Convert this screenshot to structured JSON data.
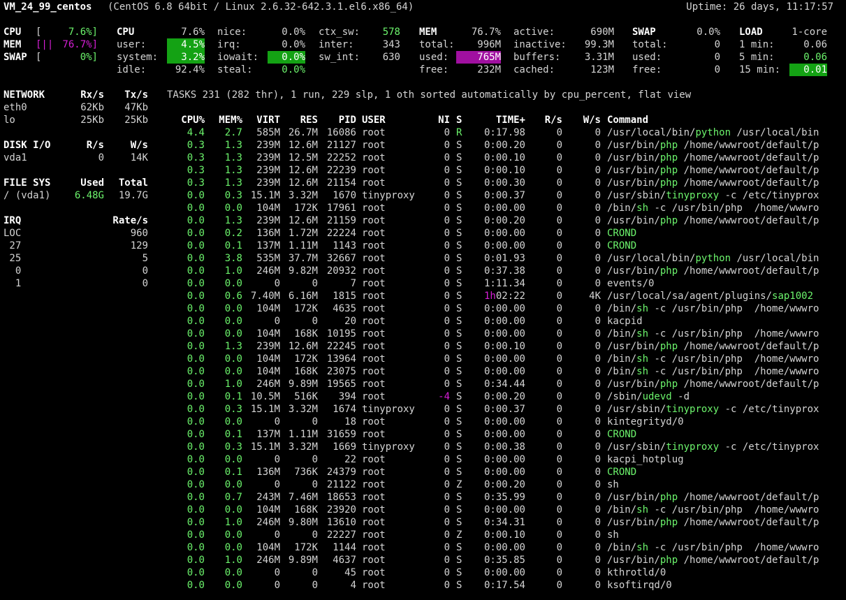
{
  "header": {
    "hostname": "VM_24_99_centos",
    "os": "(CentOS 6.8 64bit / Linux 2.6.32-642.3.1.el6.x86_64)",
    "uptime": "Uptime: 26 days, 11:17:57"
  },
  "quicklook": {
    "cpu_label": "CPU",
    "cpu_bar": "[",
    "cpu_pct": "7.6%]",
    "mem_label": "MEM",
    "mem_bar": "[||",
    "mem_pct": "76.7%]",
    "swap_label": "SWAP",
    "swap_bar": "[",
    "swap_pct": "0%]"
  },
  "cpu": {
    "title": "CPU",
    "total": "7.6%",
    "user_l": "user:",
    "user": "4.5%",
    "system_l": "system:",
    "system": "3.2%",
    "idle_l": "idle:",
    "idle": "92.4%",
    "nice_l": "nice:",
    "nice": "0.0%",
    "irq_l": "irq:",
    "irq": "0.0%",
    "iowait_l": "iowait:",
    "iowait": "0.0%",
    "steal_l": "steal:",
    "steal": "0.0%",
    "ctx_l": "ctx_sw:",
    "ctx": "578",
    "inter_l": "inter:",
    "inter": "343",
    "swint_l": "sw_int:",
    "swint": "630"
  },
  "mem": {
    "title": "MEM",
    "pct": "76.7%",
    "total_l": "total:",
    "total": "996M",
    "used_l": "used:",
    "used": "765M",
    "free_l": "free:",
    "free": "232M",
    "active_l": "active:",
    "active": "690M",
    "inactive_l": "inactive:",
    "inactive": "99.3M",
    "buffers_l": "buffers:",
    "buffers": "3.31M",
    "cached_l": "cached:",
    "cached": "123M"
  },
  "swap": {
    "title": "SWAP",
    "pct": "0.0%",
    "total_l": "total:",
    "total": "0",
    "used_l": "used:",
    "used": "0",
    "free_l": "free:",
    "free": "0"
  },
  "load": {
    "title": "LOAD",
    "cores": "1-core",
    "m1_l": "1 min:",
    "m1": "0.06",
    "m5_l": "5 min:",
    "m5": "0.06",
    "m15_l": "15 min:",
    "m15": "0.01"
  },
  "network": {
    "title": "NETWORK",
    "rx": "Rx/s",
    "tx": "Tx/s",
    "rows": [
      {
        "name": "eth0",
        "rx": "62Kb",
        "tx": "47Kb"
      },
      {
        "name": "lo",
        "rx": "25Kb",
        "tx": "25Kb"
      }
    ]
  },
  "disk": {
    "title": "DISK I/O",
    "r": "R/s",
    "w": "W/s",
    "rows": [
      {
        "name": "vda1",
        "r": "0",
        "w": "14K"
      }
    ]
  },
  "fs": {
    "title": "FILE SYS",
    "used": "Used",
    "total": "Total",
    "rows": [
      {
        "name": "/ (vda1)",
        "used": "6.48G",
        "total": "19.7G"
      }
    ]
  },
  "irq": {
    "title": "IRQ",
    "rate": "Rate/s",
    "rows": [
      {
        "name": "LOC",
        "rate": "960"
      },
      {
        "name": " 27",
        "rate": "129"
      },
      {
        "name": " 25",
        "rate": "5"
      },
      {
        "name": "  0",
        "rate": "0"
      },
      {
        "name": "  1",
        "rate": "0"
      }
    ]
  },
  "tasks_line": "TASKS 231 (282 thr), 1 run, 229 slp, 1 oth sorted automatically by cpu_percent, flat view",
  "columns": {
    "cpu": "CPU%",
    "mem": "MEM%",
    "virt": "VIRT",
    "res": "RES",
    "pid": "PID",
    "user": "USER",
    "ni": "NI",
    "s": "S",
    "time": "TIME+",
    "r": "R/s",
    "w": "W/s",
    "cmd": "Command"
  },
  "processes": [
    {
      "cpu": "4.4",
      "mem": "2.7",
      "virt": "585M",
      "res": "26.7M",
      "pid": "16086",
      "user": "root",
      "ni": "0",
      "s": "R",
      "th": "",
      "time": "0:17.98",
      "r": "0",
      "w": "0",
      "cmd": [
        "/usr/local/bin/",
        "python",
        " /usr/local/bin"
      ]
    },
    {
      "cpu": "0.3",
      "mem": "1.3",
      "virt": "239M",
      "res": "12.6M",
      "pid": "21127",
      "user": "root",
      "ni": "0",
      "s": "S",
      "th": "",
      "time": "0:00.20",
      "r": "0",
      "w": "0",
      "cmd": [
        "/usr/bin/",
        "php",
        " /home/wwwroot/default/p"
      ]
    },
    {
      "cpu": "0.3",
      "mem": "1.3",
      "virt": "239M",
      "res": "12.5M",
      "pid": "22252",
      "user": "root",
      "ni": "0",
      "s": "S",
      "th": "",
      "time": "0:00.10",
      "r": "0",
      "w": "0",
      "cmd": [
        "/usr/bin/",
        "php",
        " /home/wwwroot/default/p"
      ]
    },
    {
      "cpu": "0.3",
      "mem": "1.3",
      "virt": "239M",
      "res": "12.6M",
      "pid": "22239",
      "user": "root",
      "ni": "0",
      "s": "S",
      "th": "",
      "time": "0:00.10",
      "r": "0",
      "w": "0",
      "cmd": [
        "/usr/bin/",
        "php",
        " /home/wwwroot/default/p"
      ]
    },
    {
      "cpu": "0.3",
      "mem": "1.3",
      "virt": "239M",
      "res": "12.6M",
      "pid": "21154",
      "user": "root",
      "ni": "0",
      "s": "S",
      "th": "",
      "time": "0:00.30",
      "r": "0",
      "w": "0",
      "cmd": [
        "/usr/bin/",
        "php",
        " /home/wwwroot/default/p"
      ]
    },
    {
      "cpu": "0.0",
      "mem": "0.3",
      "virt": "15.1M",
      "res": "3.32M",
      "pid": "1670",
      "user": "tinyproxy",
      "ni": "0",
      "s": "S",
      "th": "",
      "time": "0:00.37",
      "r": "0",
      "w": "0",
      "cmd": [
        "/usr/sbin/",
        "tinyproxy",
        " -c /etc/tinyprox"
      ]
    },
    {
      "cpu": "0.0",
      "mem": "0.0",
      "virt": "104M",
      "res": "172K",
      "pid": "17961",
      "user": "root",
      "ni": "0",
      "s": "S",
      "th": "",
      "time": "0:00.00",
      "r": "0",
      "w": "0",
      "cmd": [
        "/bin/",
        "sh",
        " -c /usr/bin/php  /home/wwwro"
      ]
    },
    {
      "cpu": "0.0",
      "mem": "1.3",
      "virt": "239M",
      "res": "12.6M",
      "pid": "21159",
      "user": "root",
      "ni": "0",
      "s": "S",
      "th": "",
      "time": "0:00.20",
      "r": "0",
      "w": "0",
      "cmd": [
        "/usr/bin/",
        "php",
        " /home/wwwroot/default/p"
      ]
    },
    {
      "cpu": "0.0",
      "mem": "0.2",
      "virt": "136M",
      "res": "1.72M",
      "pid": "22224",
      "user": "root",
      "ni": "0",
      "s": "S",
      "th": "",
      "time": "0:00.00",
      "r": "0",
      "w": "0",
      "cmd": [
        "",
        "CROND",
        ""
      ]
    },
    {
      "cpu": "0.0",
      "mem": "0.1",
      "virt": "137M",
      "res": "1.11M",
      "pid": "1143",
      "user": "root",
      "ni": "0",
      "s": "S",
      "th": "",
      "time": "0:00.00",
      "r": "0",
      "w": "0",
      "cmd": [
        "",
        "CROND",
        ""
      ]
    },
    {
      "cpu": "0.0",
      "mem": "3.8",
      "virt": "535M",
      "res": "37.7M",
      "pid": "32667",
      "user": "root",
      "ni": "0",
      "s": "S",
      "th": "",
      "time": "0:01.93",
      "r": "0",
      "w": "0",
      "cmd": [
        "/usr/local/bin/",
        "python",
        " /usr/local/bin"
      ]
    },
    {
      "cpu": "0.0",
      "mem": "1.0",
      "virt": "246M",
      "res": "9.82M",
      "pid": "20932",
      "user": "root",
      "ni": "0",
      "s": "S",
      "th": "",
      "time": "0:37.38",
      "r": "0",
      "w": "0",
      "cmd": [
        "/usr/bin/",
        "php",
        " /home/wwwroot/default/p"
      ]
    },
    {
      "cpu": "0.0",
      "mem": "0.0",
      "virt": "0",
      "res": "0",
      "pid": "7",
      "user": "root",
      "ni": "0",
      "s": "S",
      "th": "",
      "time": "1:11.34",
      "r": "0",
      "w": "0",
      "cmd": [
        "events/0",
        "",
        ""
      ]
    },
    {
      "cpu": "0.0",
      "mem": "0.6",
      "virt": "7.40M",
      "res": "6.16M",
      "pid": "1815",
      "user": "root",
      "ni": "0",
      "s": "S",
      "th": "1h",
      "time": "02:22",
      "r": "0",
      "w": "4K",
      "cmd": [
        "/usr/local/sa/agent/plugins/",
        "sap1002",
        ""
      ]
    },
    {
      "cpu": "0.0",
      "mem": "0.0",
      "virt": "104M",
      "res": "172K",
      "pid": "4635",
      "user": "root",
      "ni": "0",
      "s": "S",
      "th": "",
      "time": "0:00.00",
      "r": "0",
      "w": "0",
      "cmd": [
        "/bin/",
        "sh",
        " -c /usr/bin/php  /home/wwwro"
      ]
    },
    {
      "cpu": "0.0",
      "mem": "0.0",
      "virt": "0",
      "res": "0",
      "pid": "20",
      "user": "root",
      "ni": "0",
      "s": "S",
      "th": "",
      "time": "0:00.00",
      "r": "0",
      "w": "0",
      "cmd": [
        "kacpid",
        "",
        ""
      ]
    },
    {
      "cpu": "0.0",
      "mem": "0.0",
      "virt": "104M",
      "res": "168K",
      "pid": "10195",
      "user": "root",
      "ni": "0",
      "s": "S",
      "th": "",
      "time": "0:00.00",
      "r": "0",
      "w": "0",
      "cmd": [
        "/bin/",
        "sh",
        " -c /usr/bin/php  /home/wwwro"
      ]
    },
    {
      "cpu": "0.0",
      "mem": "1.3",
      "virt": "239M",
      "res": "12.6M",
      "pid": "22245",
      "user": "root",
      "ni": "0",
      "s": "S",
      "th": "",
      "time": "0:00.10",
      "r": "0",
      "w": "0",
      "cmd": [
        "/usr/bin/",
        "php",
        " /home/wwwroot/default/p"
      ]
    },
    {
      "cpu": "0.0",
      "mem": "0.0",
      "virt": "104M",
      "res": "172K",
      "pid": "13964",
      "user": "root",
      "ni": "0",
      "s": "S",
      "th": "",
      "time": "0:00.00",
      "r": "0",
      "w": "0",
      "cmd": [
        "/bin/",
        "sh",
        " -c /usr/bin/php  /home/wwwro"
      ]
    },
    {
      "cpu": "0.0",
      "mem": "0.0",
      "virt": "104M",
      "res": "168K",
      "pid": "23075",
      "user": "root",
      "ni": "0",
      "s": "S",
      "th": "",
      "time": "0:00.00",
      "r": "0",
      "w": "0",
      "cmd": [
        "/bin/",
        "sh",
        " -c /usr/bin/php  /home/wwwro"
      ]
    },
    {
      "cpu": "0.0",
      "mem": "1.0",
      "virt": "246M",
      "res": "9.89M",
      "pid": "19565",
      "user": "root",
      "ni": "0",
      "s": "S",
      "th": "",
      "time": "0:34.44",
      "r": "0",
      "w": "0",
      "cmd": [
        "/usr/bin/",
        "php",
        " /home/wwwroot/default/p"
      ]
    },
    {
      "cpu": "0.0",
      "mem": "0.1",
      "virt": "10.5M",
      "res": "516K",
      "pid": "394",
      "user": "root",
      "ni": "-4",
      "s": "S",
      "th": "",
      "time": "0:00.20",
      "r": "0",
      "w": "0",
      "cmd": [
        "/sbin/",
        "udevd",
        " -d"
      ]
    },
    {
      "cpu": "0.0",
      "mem": "0.3",
      "virt": "15.1M",
      "res": "3.32M",
      "pid": "1674",
      "user": "tinyproxy",
      "ni": "0",
      "s": "S",
      "th": "",
      "time": "0:00.37",
      "r": "0",
      "w": "0",
      "cmd": [
        "/usr/sbin/",
        "tinyproxy",
        " -c /etc/tinyprox"
      ]
    },
    {
      "cpu": "0.0",
      "mem": "0.0",
      "virt": "0",
      "res": "0",
      "pid": "18",
      "user": "root",
      "ni": "0",
      "s": "S",
      "th": "",
      "time": "0:00.00",
      "r": "0",
      "w": "0",
      "cmd": [
        "kintegrityd/0",
        "",
        ""
      ]
    },
    {
      "cpu": "0.0",
      "mem": "0.1",
      "virt": "137M",
      "res": "1.11M",
      "pid": "31659",
      "user": "root",
      "ni": "0",
      "s": "S",
      "th": "",
      "time": "0:00.00",
      "r": "0",
      "w": "0",
      "cmd": [
        "",
        "CROND",
        ""
      ]
    },
    {
      "cpu": "0.0",
      "mem": "0.3",
      "virt": "15.1M",
      "res": "3.32M",
      "pid": "1669",
      "user": "tinyproxy",
      "ni": "0",
      "s": "S",
      "th": "",
      "time": "0:00.38",
      "r": "0",
      "w": "0",
      "cmd": [
        "/usr/sbin/",
        "tinyproxy",
        " -c /etc/tinyprox"
      ]
    },
    {
      "cpu": "0.0",
      "mem": "0.0",
      "virt": "0",
      "res": "0",
      "pid": "22",
      "user": "root",
      "ni": "0",
      "s": "S",
      "th": "",
      "time": "0:00.00",
      "r": "0",
      "w": "0",
      "cmd": [
        "kacpi_hotplug",
        "",
        ""
      ]
    },
    {
      "cpu": "0.0",
      "mem": "0.1",
      "virt": "136M",
      "res": "736K",
      "pid": "24379",
      "user": "root",
      "ni": "0",
      "s": "S",
      "th": "",
      "time": "0:00.00",
      "r": "0",
      "w": "0",
      "cmd": [
        "",
        "CROND",
        ""
      ]
    },
    {
      "cpu": "0.0",
      "mem": "0.0",
      "virt": "0",
      "res": "0",
      "pid": "21122",
      "user": "root",
      "ni": "0",
      "s": "Z",
      "th": "",
      "time": "0:00.20",
      "r": "0",
      "w": "0",
      "cmd": [
        "sh",
        "",
        ""
      ]
    },
    {
      "cpu": "0.0",
      "mem": "0.7",
      "virt": "243M",
      "res": "7.46M",
      "pid": "18653",
      "user": "root",
      "ni": "0",
      "s": "S",
      "th": "",
      "time": "0:35.99",
      "r": "0",
      "w": "0",
      "cmd": [
        "/usr/bin/",
        "php",
        " /home/wwwroot/default/p"
      ]
    },
    {
      "cpu": "0.0",
      "mem": "0.0",
      "virt": "104M",
      "res": "168K",
      "pid": "23920",
      "user": "root",
      "ni": "0",
      "s": "S",
      "th": "",
      "time": "0:00.00",
      "r": "0",
      "w": "0",
      "cmd": [
        "/bin/",
        "sh",
        " -c /usr/bin/php  /home/wwwro"
      ]
    },
    {
      "cpu": "0.0",
      "mem": "1.0",
      "virt": "246M",
      "res": "9.80M",
      "pid": "13610",
      "user": "root",
      "ni": "0",
      "s": "S",
      "th": "",
      "time": "0:34.31",
      "r": "0",
      "w": "0",
      "cmd": [
        "/usr/bin/",
        "php",
        " /home/wwwroot/default/p"
      ]
    },
    {
      "cpu": "0.0",
      "mem": "0.0",
      "virt": "0",
      "res": "0",
      "pid": "22227",
      "user": "root",
      "ni": "0",
      "s": "Z",
      "th": "",
      "time": "0:00.10",
      "r": "0",
      "w": "0",
      "cmd": [
        "sh",
        "",
        ""
      ]
    },
    {
      "cpu": "0.0",
      "mem": "0.0",
      "virt": "104M",
      "res": "172K",
      "pid": "1144",
      "user": "root",
      "ni": "0",
      "s": "S",
      "th": "",
      "time": "0:00.00",
      "r": "0",
      "w": "0",
      "cmd": [
        "/bin/",
        "sh",
        " -c /usr/bin/php  /home/wwwro"
      ]
    },
    {
      "cpu": "0.0",
      "mem": "1.0",
      "virt": "246M",
      "res": "9.89M",
      "pid": "4637",
      "user": "root",
      "ni": "0",
      "s": "S",
      "th": "",
      "time": "0:35.85",
      "r": "0",
      "w": "0",
      "cmd": [
        "/usr/bin/",
        "php",
        " /home/wwwroot/default/p"
      ]
    },
    {
      "cpu": "0.0",
      "mem": "0.0",
      "virt": "0",
      "res": "0",
      "pid": "45",
      "user": "root",
      "ni": "0",
      "s": "S",
      "th": "",
      "time": "0:00.00",
      "r": "0",
      "w": "0",
      "cmd": [
        "kthrotld/0",
        "",
        ""
      ]
    },
    {
      "cpu": "0.0",
      "mem": "0.0",
      "virt": "0",
      "res": "0",
      "pid": "4",
      "user": "root",
      "ni": "0",
      "s": "S",
      "th": "",
      "time": "0:17.54",
      "r": "0",
      "w": "0",
      "cmd": [
        "ksoftirqd/0",
        "",
        ""
      ]
    }
  ]
}
